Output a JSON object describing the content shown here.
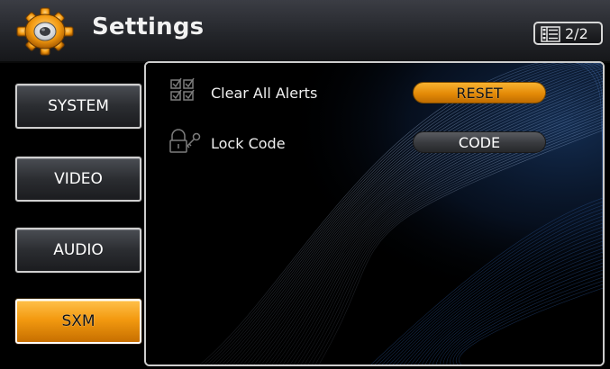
{
  "header": {
    "title": "Settings",
    "icon": "gear-icon",
    "page_indicator": "2/2",
    "page_icon": "page-list-icon"
  },
  "sidebar": {
    "items": [
      {
        "label": "SYSTEM",
        "active": false
      },
      {
        "label": "VIDEO",
        "active": false
      },
      {
        "label": "AUDIO",
        "active": false
      },
      {
        "label": "SXM",
        "active": true
      }
    ]
  },
  "content": {
    "rows": [
      {
        "label": "Clear All Alerts",
        "icon": "alerts-checkbox-icon",
        "button": "RESET",
        "button_style": "orange"
      },
      {
        "label": "Lock Code",
        "icon": "lock-key-icon",
        "button": "CODE",
        "button_style": "dark"
      }
    ]
  },
  "colors": {
    "accent": "#f39a10",
    "header": "#2b2d32",
    "background": "#000000"
  }
}
